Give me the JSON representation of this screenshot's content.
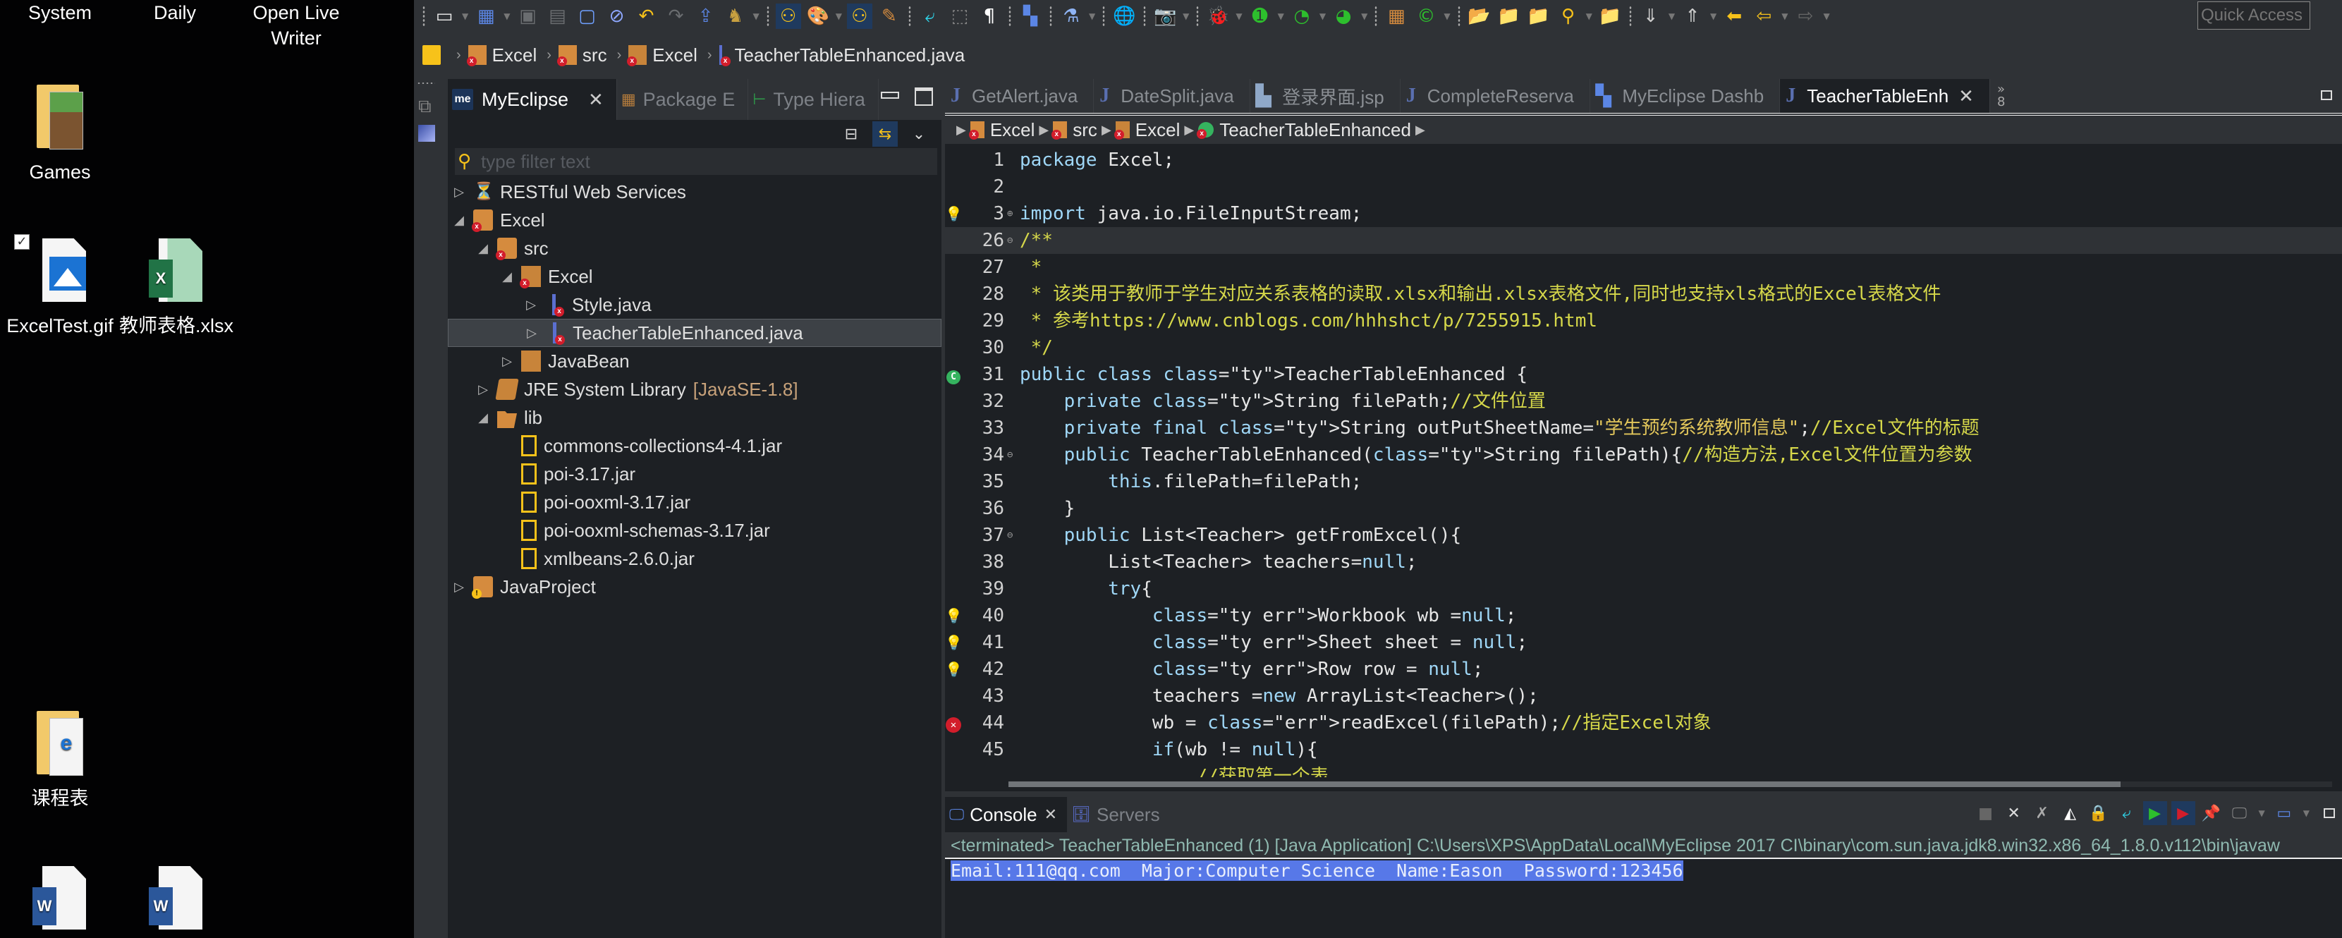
{
  "desktop": {
    "items": [
      {
        "label": "System",
        "icon": "system-icon"
      },
      {
        "label": "Daily",
        "icon": "daily-icon"
      },
      {
        "label": "Open Live Writer",
        "icon": "live-writer-icon"
      },
      {
        "label": "Games",
        "icon": "folder-icon"
      },
      {
        "label": "ExcelTest.gif",
        "icon": "image-file-icon",
        "selected": true
      },
      {
        "label": "教师表格.xlsx",
        "icon": "excel-file-icon"
      },
      {
        "label": "课程表",
        "icon": "folder-icon"
      },
      {
        "label": "",
        "icon": "word-file-icon"
      },
      {
        "label": "",
        "icon": "word-file-icon"
      }
    ]
  },
  "toolbar": {
    "quick_access_placeholder": "Quick Access"
  },
  "breadcrumb": {
    "items": [
      "Excel",
      "src",
      "Excel",
      "TeacherTableEnhanced.java"
    ]
  },
  "explorer": {
    "tabs": [
      {
        "label": "MyEclipse",
        "active": true
      },
      {
        "label": "Package E",
        "active": false
      },
      {
        "label": "Type Hiera",
        "active": false
      }
    ],
    "filter_placeholder": "type filter text",
    "tree": [
      {
        "label": "RESTful Web Services",
        "depth": 0,
        "expanded": false
      },
      {
        "label": "Excel",
        "depth": 0,
        "expanded": true,
        "error": true
      },
      {
        "label": "src",
        "depth": 1,
        "expanded": true,
        "error": true
      },
      {
        "label": "Excel",
        "depth": 2,
        "expanded": true,
        "error": true
      },
      {
        "label": "Style.java",
        "depth": 3,
        "expanded": false,
        "error": true
      },
      {
        "label": "TeacherTableEnhanced.java",
        "depth": 3,
        "expanded": false,
        "error": true,
        "selected": true
      },
      {
        "label": "JavaBean",
        "depth": 2,
        "expanded": false
      },
      {
        "label": "JRE System Library",
        "decoration": "[JavaSE-1.8]",
        "depth": 1,
        "expanded": false
      },
      {
        "label": "lib",
        "depth": 1,
        "expanded": true
      },
      {
        "label": "commons-collections4-4.1.jar",
        "depth": 2
      },
      {
        "label": "poi-3.17.jar",
        "depth": 2
      },
      {
        "label": "poi-ooxml-3.17.jar",
        "depth": 2
      },
      {
        "label": "poi-ooxml-schemas-3.17.jar",
        "depth": 2
      },
      {
        "label": "xmlbeans-2.6.0.jar",
        "depth": 2
      },
      {
        "label": "JavaProject",
        "depth": 0,
        "expanded": false,
        "warning": true
      }
    ]
  },
  "editor": {
    "tabs": [
      {
        "label": "GetAlert.java",
        "active": false
      },
      {
        "label": "DateSplit.java",
        "active": false
      },
      {
        "label": "登录界面.jsp",
        "active": false
      },
      {
        "label": "CompleteReserva",
        "active": false
      },
      {
        "label": "MyEclipse Dashb",
        "active": false
      },
      {
        "label": "TeacherTableEnh",
        "active": true
      }
    ],
    "overflow_count": "8",
    "breadcrumb": [
      "Excel",
      "src",
      "Excel",
      "TeacherTableEnhanced"
    ],
    "lines": [
      {
        "n": "1",
        "text": "package Excel;"
      },
      {
        "n": "2",
        "text": ""
      },
      {
        "n": "3",
        "text": "import java.io.FileInputStream;",
        "marker": "warning-bulb",
        "fold": "expand"
      },
      {
        "n": "26",
        "text": "/**",
        "fold": "collapse",
        "current": true
      },
      {
        "n": "27",
        "text": " *"
      },
      {
        "n": "28",
        "text": " * 该类用于教师于学生对应关系表格的读取.xlsx和输出.xlsx表格文件,同时也支持xls格式的Excel表格文件"
      },
      {
        "n": "29",
        "text": " * 参考https://www.cnblogs.com/hhhshct/p/7255915.html"
      },
      {
        "n": "30",
        "text": " */"
      },
      {
        "n": "31",
        "text": "public class TeacherTableEnhanced {",
        "marker": "class"
      },
      {
        "n": "32",
        "text": "    private String filePath;//文件位置"
      },
      {
        "n": "33",
        "text": "    private final String outPutSheetName=\"学生预约系统教师信息\";//Excel文件的标题"
      },
      {
        "n": "34",
        "text": "    public TeacherTableEnhanced(String filePath){//构造方法,Excel文件位置为参数",
        "fold": "collapse"
      },
      {
        "n": "35",
        "text": "        this.filePath=filePath;"
      },
      {
        "n": "36",
        "text": "    }"
      },
      {
        "n": "37",
        "text": "    public List<Teacher> getFromExcel(){",
        "fold": "collapse"
      },
      {
        "n": "38",
        "text": "        List<Teacher> teachers=null;"
      },
      {
        "n": "39",
        "text": "        try{"
      },
      {
        "n": "40",
        "text": "            Workbook wb =null;",
        "marker": "warning-bulb"
      },
      {
        "n": "41",
        "text": "            Sheet sheet = null;",
        "marker": "warning-bulb"
      },
      {
        "n": "42",
        "text": "            Row row = null;",
        "marker": "warning-bulb"
      },
      {
        "n": "43",
        "text": "            teachers =new ArrayList<Teacher>();"
      },
      {
        "n": "44",
        "text": "            wb = readExcel(filePath);//指定Excel对象",
        "marker": "error"
      },
      {
        "n": "45",
        "text": "            if(wb != null){"
      },
      {
        "n": "",
        "text": "                //获取第一个表"
      }
    ]
  },
  "console": {
    "tabs": [
      {
        "label": "Console",
        "active": true
      },
      {
        "label": "Servers",
        "active": false
      }
    ],
    "status": "<terminated> TeacherTableEnhanced (1) [Java Application] C:\\Users\\XPS\\AppData\\Local\\MyEclipse 2017 CI\\binary\\com.sun.java.jdk8.win32.x86_64_1.8.0.v112\\bin\\javaw",
    "output": "Email:111@qq.com  Major:Computer Science  Name:Eason  Password:123456"
  },
  "colors": {
    "keyword": "#9fd7f7",
    "type": "#e06b6b",
    "comment": "#d6d84a",
    "string": "#e3c75b",
    "selection": "#5778e8",
    "accent": "#f7c21a"
  }
}
